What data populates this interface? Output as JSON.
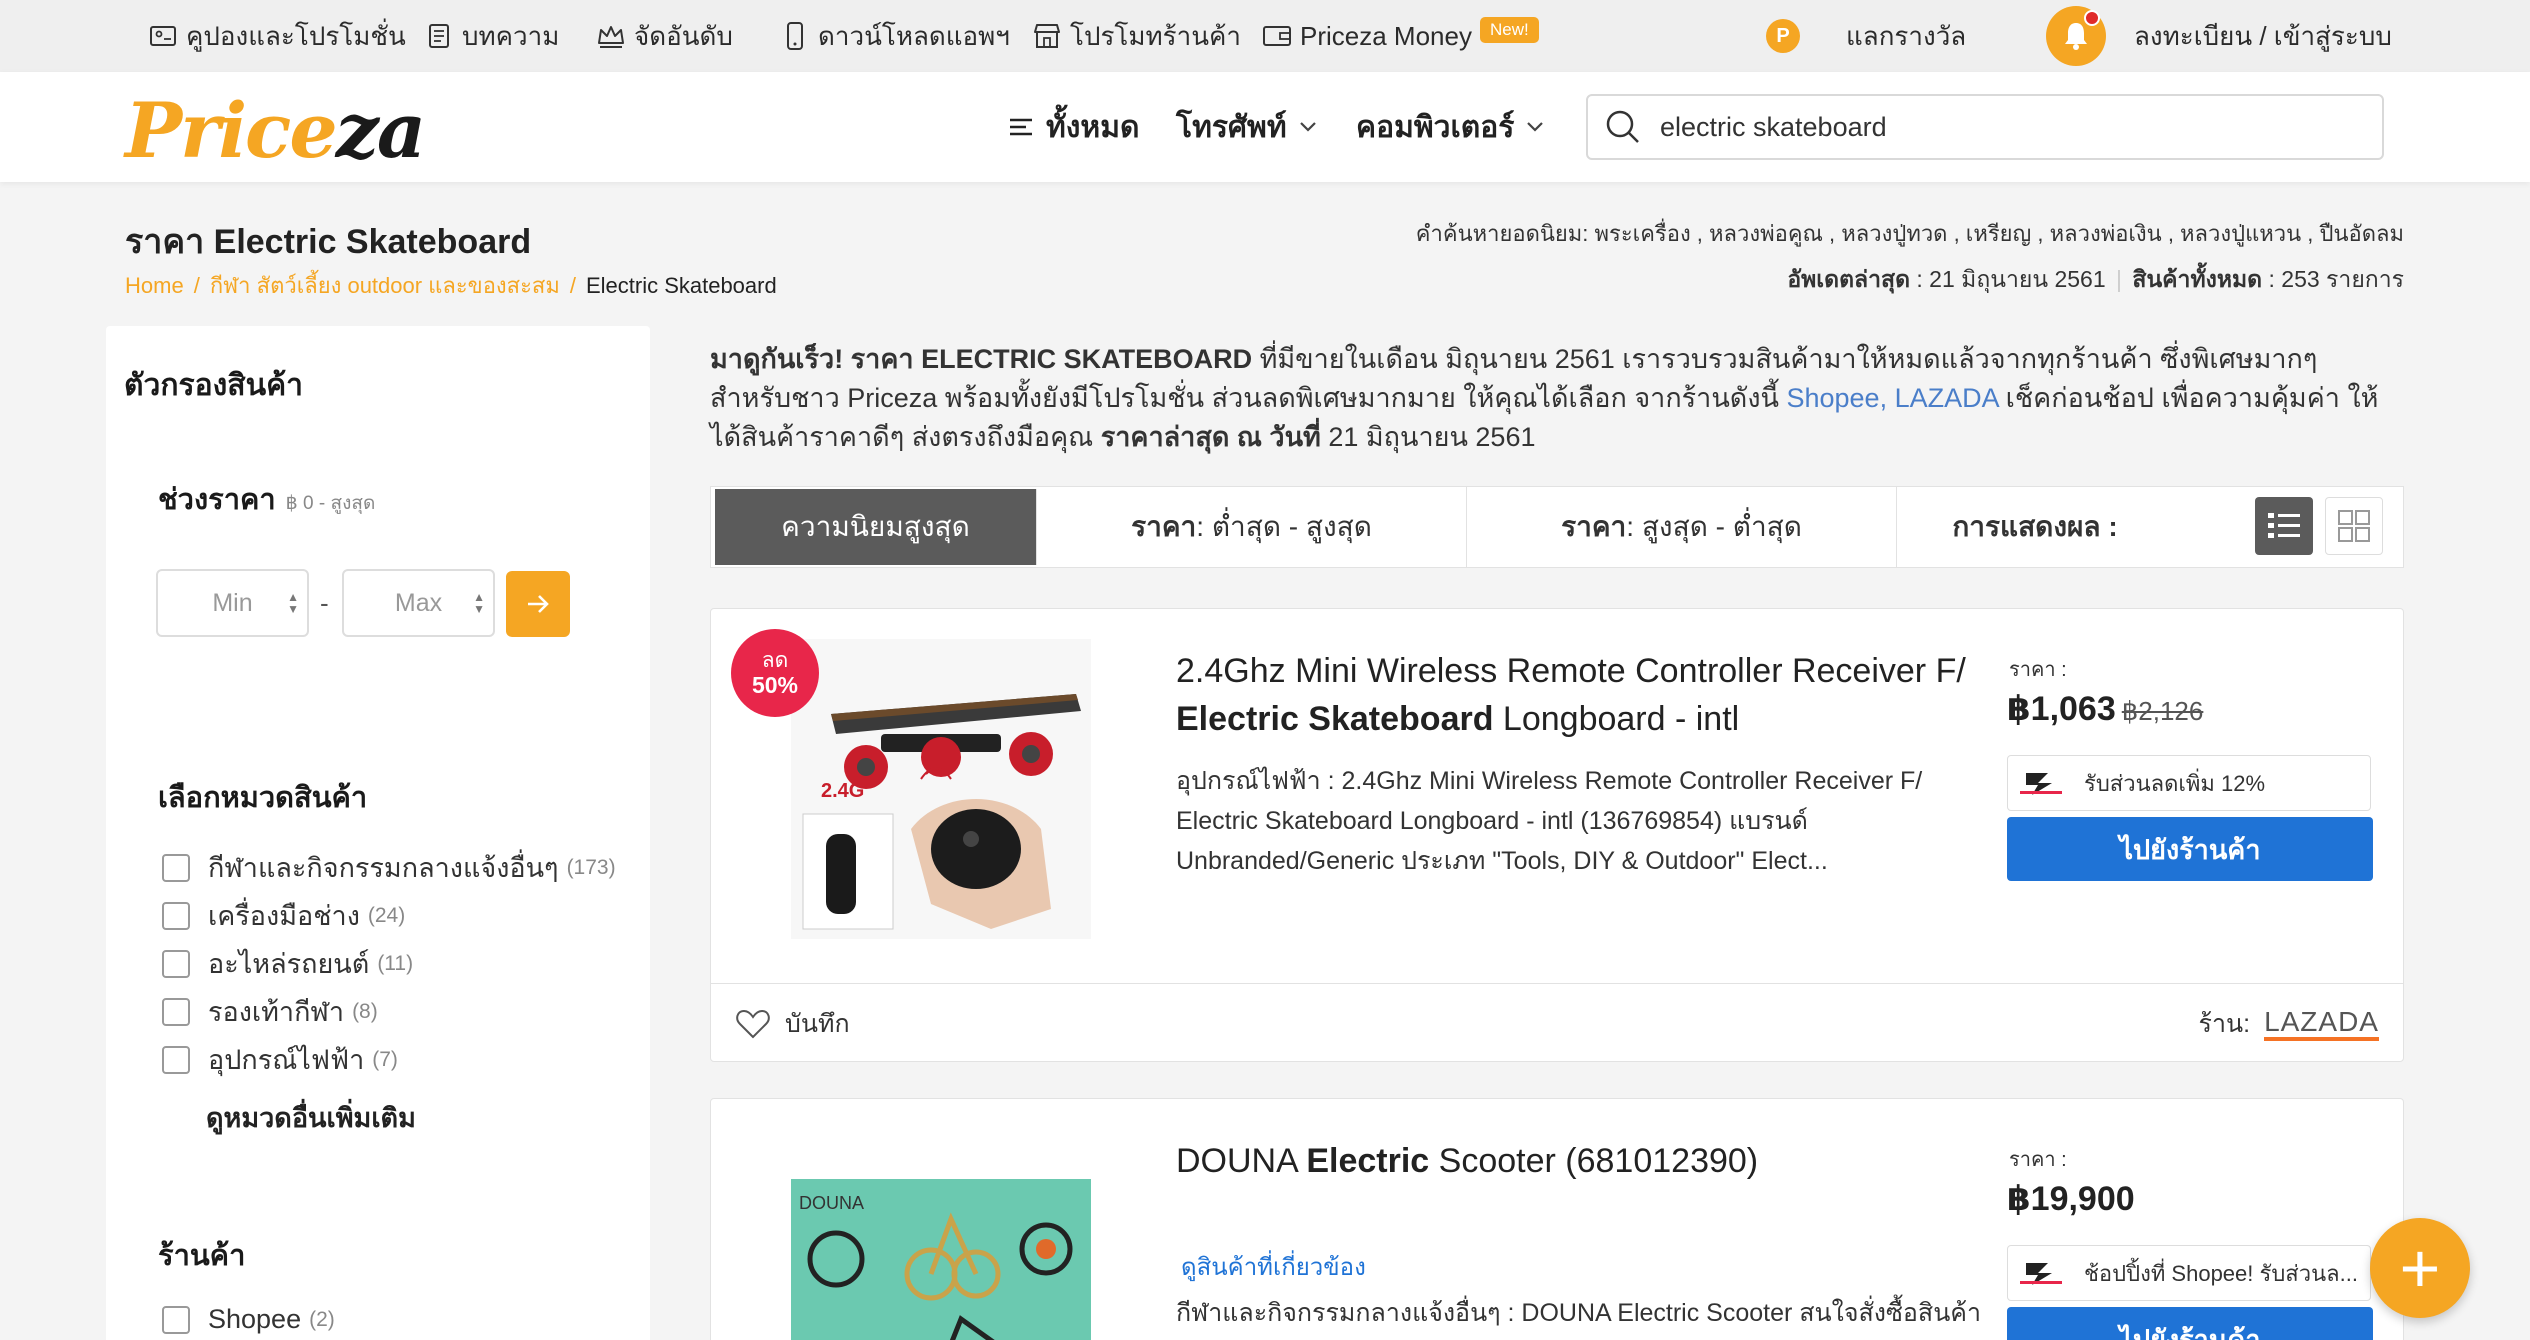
{
  "topbar": {
    "coupons": "คูปองและโปรโมชั่น",
    "articles": "บทความ",
    "ranking": "จัดอันดับ",
    "download_app": "ดาวน์โหลดแอพฯ",
    "shop_promo": "โปรโมทร้านค้า",
    "money": "Priceza Money",
    "new_badge": "New!",
    "coin_letter": "P",
    "rewards": "แลกรางวัล",
    "login": "ลงทะเบียน / เข้าสู่ระบบ"
  },
  "header": {
    "logo_part1": "Price",
    "logo_part2": "za",
    "nav_all": "ทั้งหมด",
    "nav_phone": "โทรศัพท์",
    "nav_computer": "คอมพิวเตอร์",
    "search_value": "electric skateboard"
  },
  "page": {
    "title": "ราคา Electric Skateboard",
    "breadcrumb": [
      "Home",
      "กีฬา สัตว์เลี้ยง outdoor และของสะสม",
      "Electric Skateboard"
    ],
    "breadcrumb_sep": "/",
    "popular_label": "คำค้นหายอดนิยม:",
    "popular_terms": "พระเครื่อง , หลวงพ่อคูณ , หลวงปู่ทวด , เหรียญ , หลวงพ่อเงิน , หลวงปู่แหวน , ปืนอัดลม",
    "updated_label": "อัพเดตล่าสุด",
    "updated_value": ": 21 มิถุนายน 2561",
    "total_label": "สินค้าทั้งหมด",
    "total_value": ": 253 รายการ"
  },
  "filters": {
    "title": "ตัวกรองสินค้า",
    "price_range": "ช่วงราคา",
    "price_hint": "฿ 0 - สูงสุด",
    "min_placeholder": "Min",
    "max_placeholder": "Max",
    "range_dash": "-",
    "category_title": "เลือกหมวดสินค้า",
    "categories": [
      {
        "label": "กีฬาและกิจกรรมกลางแจ้งอื่นๆ",
        "count": "(173)"
      },
      {
        "label": "เครื่องมือช่าง",
        "count": "(24)"
      },
      {
        "label": "อะไหล่รถยนต์",
        "count": "(11)"
      },
      {
        "label": "รองเท้ากีฬา",
        "count": "(8)"
      },
      {
        "label": "อุปกรณ์ไฟฟ้า",
        "count": "(7)"
      }
    ],
    "more_categories": "ดูหมวดอื่นเพิ่มเติม",
    "shop_title": "ร้านค้า",
    "shops": [
      {
        "label": "Shopee",
        "count": "(2)"
      }
    ]
  },
  "intro": {
    "lead": "มาดูกันเร็ว! ราคา ELECTRIC SKATEBOARD",
    "text1": " ที่มีขายในเดือน มิถุนายน 2561 เรารวบรวมสินค้ามาให้หมดแล้วจากทุกร้านค้า ซึ่งพิเศษมากๆ สำหรับชาว Priceza พร้อมทั้งยังมีโปรโมชั่น ส่วนลดพิเศษมากมาย ให้คุณได้เลือก จากร้านดังนี้ ",
    "shops": "Shopee, LAZADA",
    "text2": " เช็คก่อนช้อป เพื่อความคุ้มค่า ให้ได้สินค้าราคาดีๆ ส่งตรงถึงมือคุณ ",
    "latest_label": "ราคาล่าสุด ณ วันที่",
    "latest_date": " 21 มิถุนายน 2561"
  },
  "sort": {
    "popular": "ความนิยมสูงสุด",
    "price_label": "ราคา",
    "low_high": " : ต่ำสุด - สูงสุด",
    "high_low": " : สูงสุด - ต่ำสุด",
    "display_label": "การแสดงผล :"
  },
  "products": [
    {
      "discount_label": "ลด",
      "discount_value": "50%",
      "title_pre": "2.4Ghz Mini Wireless Remote Controller Receiver F/ ",
      "title_bold": "Electric Skateboard",
      "title_post": " Longboard - intl",
      "description": "อุปกรณ์ไฟฟ้า : 2.4Ghz Mini Wireless Remote Controller Receiver F/ Electric Skateboard Longboard - intl (136769854) แบรนด์ Unbranded/Generic ประเภท \"Tools, DIY & Outdoor\" Elect...",
      "price_label": "ราคา :",
      "price": "฿1,063",
      "old_price": "฿2,126",
      "promo": "รับส่วนลดเพิ่ม 12%",
      "go_button": "ไปยังร้านค้า",
      "save_label": "บันทึก",
      "store_label": "ร้าน:",
      "store_name": "LAZADA",
      "image_label": "2.4G"
    },
    {
      "title_pre": "DOUNA ",
      "title_bold": "Electric",
      "title_post": " Scooter (681012390)",
      "related": "ดูสินค้าที่เกี่ยวข้อง",
      "description": "กีฬาและกิจกรรมกลางแจ้งอื่นๆ : DOUNA Electric Scooter สนใจสั่งซื้อสินค้า",
      "price_label": "ราคา :",
      "price": "฿19,900",
      "promo": "ช้อปปิ้งที่ Shopee! รับส่วนล...",
      "go_button": "ไปยังร้านค้า",
      "image_label": "DOUNA"
    }
  ],
  "fab_symbol": "+",
  "colors": {
    "brand_orange": "#f5a623",
    "cta_blue": "#1f73d6",
    "discount_red": "#e8264a",
    "lazada_orange": "#f57224"
  }
}
